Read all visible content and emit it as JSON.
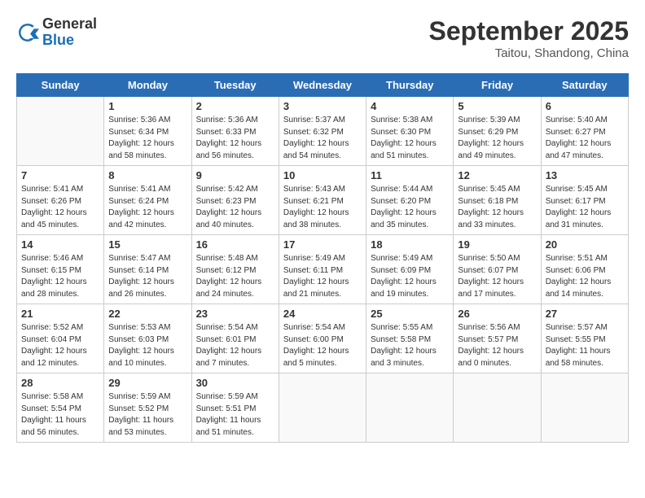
{
  "header": {
    "logo_general": "General",
    "logo_blue": "Blue",
    "month_title": "September 2025",
    "location": "Taitou, Shandong, China"
  },
  "weekdays": [
    "Sunday",
    "Monday",
    "Tuesday",
    "Wednesday",
    "Thursday",
    "Friday",
    "Saturday"
  ],
  "weeks": [
    [
      {
        "day": "",
        "info": ""
      },
      {
        "day": "1",
        "info": "Sunrise: 5:36 AM\nSunset: 6:34 PM\nDaylight: 12 hours\nand 58 minutes."
      },
      {
        "day": "2",
        "info": "Sunrise: 5:36 AM\nSunset: 6:33 PM\nDaylight: 12 hours\nand 56 minutes."
      },
      {
        "day": "3",
        "info": "Sunrise: 5:37 AM\nSunset: 6:32 PM\nDaylight: 12 hours\nand 54 minutes."
      },
      {
        "day": "4",
        "info": "Sunrise: 5:38 AM\nSunset: 6:30 PM\nDaylight: 12 hours\nand 51 minutes."
      },
      {
        "day": "5",
        "info": "Sunrise: 5:39 AM\nSunset: 6:29 PM\nDaylight: 12 hours\nand 49 minutes."
      },
      {
        "day": "6",
        "info": "Sunrise: 5:40 AM\nSunset: 6:27 PM\nDaylight: 12 hours\nand 47 minutes."
      }
    ],
    [
      {
        "day": "7",
        "info": "Sunrise: 5:41 AM\nSunset: 6:26 PM\nDaylight: 12 hours\nand 45 minutes."
      },
      {
        "day": "8",
        "info": "Sunrise: 5:41 AM\nSunset: 6:24 PM\nDaylight: 12 hours\nand 42 minutes."
      },
      {
        "day": "9",
        "info": "Sunrise: 5:42 AM\nSunset: 6:23 PM\nDaylight: 12 hours\nand 40 minutes."
      },
      {
        "day": "10",
        "info": "Sunrise: 5:43 AM\nSunset: 6:21 PM\nDaylight: 12 hours\nand 38 minutes."
      },
      {
        "day": "11",
        "info": "Sunrise: 5:44 AM\nSunset: 6:20 PM\nDaylight: 12 hours\nand 35 minutes."
      },
      {
        "day": "12",
        "info": "Sunrise: 5:45 AM\nSunset: 6:18 PM\nDaylight: 12 hours\nand 33 minutes."
      },
      {
        "day": "13",
        "info": "Sunrise: 5:45 AM\nSunset: 6:17 PM\nDaylight: 12 hours\nand 31 minutes."
      }
    ],
    [
      {
        "day": "14",
        "info": "Sunrise: 5:46 AM\nSunset: 6:15 PM\nDaylight: 12 hours\nand 28 minutes."
      },
      {
        "day": "15",
        "info": "Sunrise: 5:47 AM\nSunset: 6:14 PM\nDaylight: 12 hours\nand 26 minutes."
      },
      {
        "day": "16",
        "info": "Sunrise: 5:48 AM\nSunset: 6:12 PM\nDaylight: 12 hours\nand 24 minutes."
      },
      {
        "day": "17",
        "info": "Sunrise: 5:49 AM\nSunset: 6:11 PM\nDaylight: 12 hours\nand 21 minutes."
      },
      {
        "day": "18",
        "info": "Sunrise: 5:49 AM\nSunset: 6:09 PM\nDaylight: 12 hours\nand 19 minutes."
      },
      {
        "day": "19",
        "info": "Sunrise: 5:50 AM\nSunset: 6:07 PM\nDaylight: 12 hours\nand 17 minutes."
      },
      {
        "day": "20",
        "info": "Sunrise: 5:51 AM\nSunset: 6:06 PM\nDaylight: 12 hours\nand 14 minutes."
      }
    ],
    [
      {
        "day": "21",
        "info": "Sunrise: 5:52 AM\nSunset: 6:04 PM\nDaylight: 12 hours\nand 12 minutes."
      },
      {
        "day": "22",
        "info": "Sunrise: 5:53 AM\nSunset: 6:03 PM\nDaylight: 12 hours\nand 10 minutes."
      },
      {
        "day": "23",
        "info": "Sunrise: 5:54 AM\nSunset: 6:01 PM\nDaylight: 12 hours\nand 7 minutes."
      },
      {
        "day": "24",
        "info": "Sunrise: 5:54 AM\nSunset: 6:00 PM\nDaylight: 12 hours\nand 5 minutes."
      },
      {
        "day": "25",
        "info": "Sunrise: 5:55 AM\nSunset: 5:58 PM\nDaylight: 12 hours\nand 3 minutes."
      },
      {
        "day": "26",
        "info": "Sunrise: 5:56 AM\nSunset: 5:57 PM\nDaylight: 12 hours\nand 0 minutes."
      },
      {
        "day": "27",
        "info": "Sunrise: 5:57 AM\nSunset: 5:55 PM\nDaylight: 11 hours\nand 58 minutes."
      }
    ],
    [
      {
        "day": "28",
        "info": "Sunrise: 5:58 AM\nSunset: 5:54 PM\nDaylight: 11 hours\nand 56 minutes."
      },
      {
        "day": "29",
        "info": "Sunrise: 5:59 AM\nSunset: 5:52 PM\nDaylight: 11 hours\nand 53 minutes."
      },
      {
        "day": "30",
        "info": "Sunrise: 5:59 AM\nSunset: 5:51 PM\nDaylight: 11 hours\nand 51 minutes."
      },
      {
        "day": "",
        "info": ""
      },
      {
        "day": "",
        "info": ""
      },
      {
        "day": "",
        "info": ""
      },
      {
        "day": "",
        "info": ""
      }
    ]
  ]
}
